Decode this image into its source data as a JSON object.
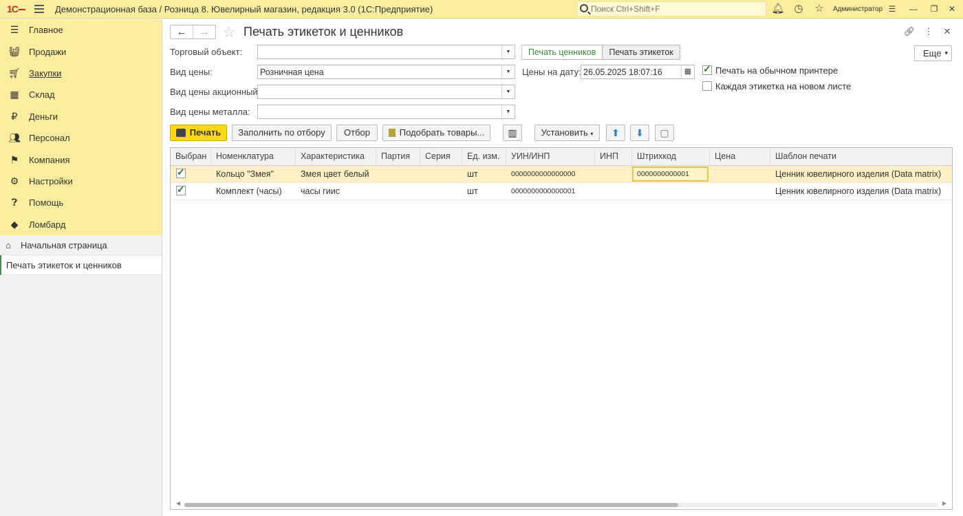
{
  "app": {
    "title": "Демонстрационная база / Розница 8. Ювелирный магазин, редакция 3.0  (1С:Предприятие)",
    "search_placeholder": "Поиск Ctrl+Shift+F",
    "user": "Администратор"
  },
  "sidebar": {
    "items": [
      {
        "label": "Главное",
        "icon": "menu-lines-icon"
      },
      {
        "label": "Продажи",
        "icon": "basket-icon"
      },
      {
        "label": "Закупки",
        "icon": "cart-icon"
      },
      {
        "label": "Склад",
        "icon": "warehouse-icon"
      },
      {
        "label": "Деньги",
        "icon": "ruble-icon"
      },
      {
        "label": "Персонал",
        "icon": "people-icon"
      },
      {
        "label": "Компания",
        "icon": "flag-icon"
      },
      {
        "label": "Настройки",
        "icon": "gear-icon"
      },
      {
        "label": "Помощь",
        "icon": "help-icon"
      },
      {
        "label": "Ломбард",
        "icon": "diamond-icon"
      }
    ],
    "open_pages": [
      {
        "label": "Начальная страница"
      },
      {
        "label": "Печать этикеток и ценников"
      }
    ]
  },
  "form": {
    "title": "Печать этикеток и ценников",
    "fields": {
      "trade_object_label": "Торговый объект:",
      "trade_object_value": "",
      "price_type_label": "Вид цены:",
      "price_type_value": "Розничная цена",
      "promo_price_label": "Вид цены акционный:",
      "promo_price_value": "",
      "metal_price_label": "Вид цены металла:",
      "metal_price_value": "",
      "date_label": "Цены на дату:",
      "date_value": "26.05.2025 18:07:16"
    },
    "mode_tabs": [
      "Печать ценников",
      "Печать этикеток"
    ],
    "more_label": "Еще",
    "checkboxes": [
      {
        "label": "Печать на обычном принтере",
        "checked": true
      },
      {
        "label": "Каждая этикетка на новом листе",
        "checked": false
      }
    ],
    "toolbar": {
      "print": "Печать",
      "fill_by_filter": "Заполнить по отбору",
      "filter": "Отбор",
      "pick_goods": "Подобрать товары...",
      "set": "Установить"
    }
  },
  "table": {
    "columns": [
      "Выбран",
      "Номенклатура",
      "Характеристика",
      "Партия",
      "Серия",
      "Ед. изм.",
      "УИН/ИНП",
      "ИНП",
      "Штрихкод",
      "Цена",
      "Шаблон печати"
    ],
    "rows": [
      {
        "selected": true,
        "item": "Кольцо \"Змея\"",
        "characteristic": "Змея цвет белый",
        "batch": "",
        "series": "",
        "unit": "шт",
        "uin": "0000000000000000",
        "inp": "",
        "barcode": "0000000000001",
        "price": "",
        "template": "Ценник ювелирного изделия (Data matrix)"
      },
      {
        "selected": true,
        "item": "Комплект (часы)",
        "characteristic": "часы гиис",
        "batch": "",
        "series": "",
        "unit": "шт",
        "uin": "0000000000000001",
        "inp": "",
        "barcode": "",
        "price": "",
        "template": "Ценник ювелирного изделия (Data matrix)"
      }
    ]
  },
  "colors": {
    "accent": "#fbed9e",
    "primary_button": "#fbd80f",
    "selected_row": "#fdf0c4",
    "check_green": "#2c7a2c"
  }
}
